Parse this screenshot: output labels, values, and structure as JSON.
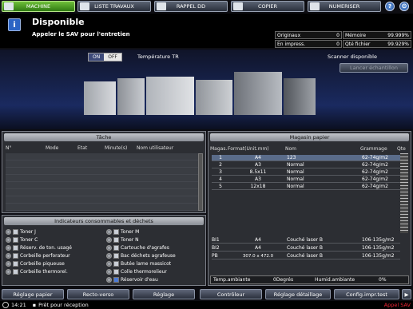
{
  "tabs": {
    "machine": "MACHINE",
    "job_list": "LISTE TRAVAUX",
    "recall": "RAPPEL DD",
    "copy": "COPIER",
    "scan": "NUMERISER"
  },
  "status": {
    "title": "Disponible",
    "message": "Appeler le SAV pour l'entretien"
  },
  "counters": {
    "originals_label": "Originaux",
    "originals_value": "0",
    "in_print_label": "En impress.",
    "in_print_value": "0",
    "memory_label": "Mémoire",
    "memory_value": "99.999%",
    "file_label": "Qté fichier",
    "file_value": "99.929%"
  },
  "tr": {
    "on": "ON",
    "off": "OFF",
    "label": "Température TR"
  },
  "scanner": {
    "status": "Scanner disponible",
    "sample_button": "Lancer échantillon"
  },
  "task": {
    "title": "Tâche",
    "columns": [
      "N°",
      "Mode",
      "Etat",
      "Minute(s)",
      "Nom utilisateur"
    ]
  },
  "consumables": {
    "title": "Indicateurs consommables et déchets",
    "left": [
      "Toner J",
      "Toner C",
      "Réserv. de ton. usagé",
      "Corbeille perforateur",
      "Corbeille piqueuse",
      "Corbeille thermorel."
    ],
    "right": [
      "Toner M",
      "Toner N",
      "Cartouche d'agrafes",
      "Bac déchets agrafeuse",
      "Butée lame massicot",
      "Colle thermorelieur",
      "Réservoir d'eau"
    ]
  },
  "paper": {
    "title": "Magasin papier",
    "columns": [
      "Magas.",
      "Format(Unit.mm)",
      "Nom",
      "Grammage",
      "Qte"
    ],
    "rows": [
      [
        "1",
        "A4",
        "123",
        "62-74g/m2"
      ],
      [
        "2",
        "A3",
        "Normal",
        "62-74g/m2"
      ],
      [
        "3",
        "8.5x11",
        "Normal",
        "62-74g/m2"
      ],
      [
        "4",
        "A3",
        "Normal",
        "62-74g/m2"
      ],
      [
        "5",
        "12x18",
        "Normal",
        "62-74g/m2"
      ]
    ],
    "inserts": [
      [
        "BI1",
        "A4",
        "Couché laser B",
        "106-135g/m2"
      ],
      [
        "BI2",
        "A4",
        "Couché laser B",
        "106-135g/m2"
      ],
      [
        "PB",
        "307.0 x 472.0",
        "Couché laser B",
        "106-135g/m2"
      ]
    ],
    "temp_label": "Temp.ambiante",
    "temp_value": "0Degrés",
    "humid_label": "Humid.ambiante",
    "humid_value": "0%"
  },
  "bottom": {
    "buttons": [
      "Réglage papier",
      "Recto-verso",
      "Réglage",
      "Contrôleur",
      "Réglage détaillage",
      "Config.impr.test"
    ]
  },
  "footer": {
    "time": "14:21",
    "ready": "Prêt pour réception",
    "sav": "Appel SAV"
  }
}
